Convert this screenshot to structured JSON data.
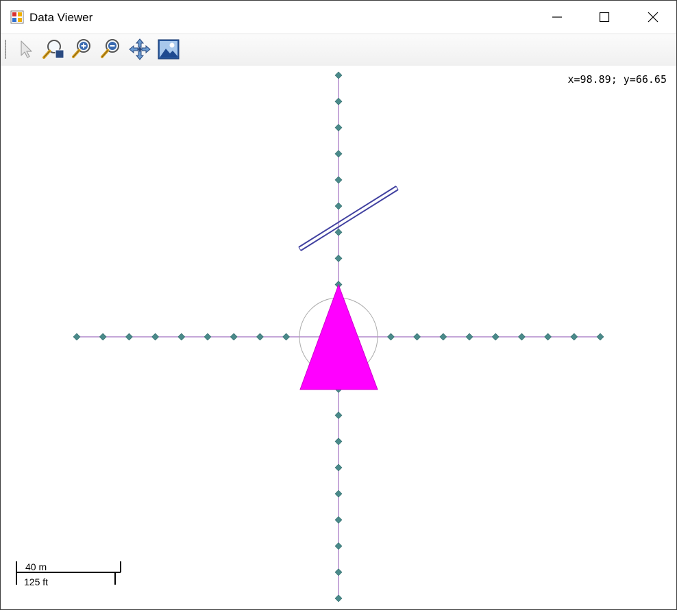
{
  "window": {
    "title": "Data Viewer"
  },
  "toolbar": {
    "tools": [
      {
        "name": "select-tool",
        "icon": "arrow-pointer-icon"
      },
      {
        "name": "zoom-window-tool",
        "icon": "zoom-window-icon"
      },
      {
        "name": "zoom-in-tool",
        "icon": "zoom-in-icon"
      },
      {
        "name": "zoom-out-tool",
        "icon": "zoom-out-icon"
      },
      {
        "name": "pan-tool",
        "icon": "pan-arrows-icon"
      },
      {
        "name": "full-extent-tool",
        "icon": "picture-icon"
      }
    ]
  },
  "map": {
    "coordinates": "x=98.89; y=66.65",
    "scale_metric": "40 m",
    "scale_imperial": "125 ft",
    "colors": {
      "grid_line": "#a070c0",
      "grid_point": "#4a8a8a",
      "triangle_fill": "#ff00ff",
      "wall_line": "#4040a0",
      "circle": "#aaaaaa"
    }
  }
}
